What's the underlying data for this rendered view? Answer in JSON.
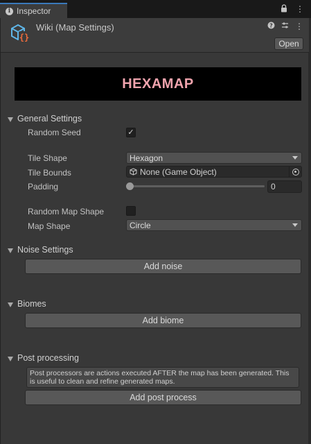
{
  "tab": {
    "title": "Inspector",
    "icon": "info-icon"
  },
  "tab_actions": [
    {
      "name": "lock-icon",
      "glyph": "🔒"
    },
    {
      "name": "more-icon",
      "glyph": "⋮"
    }
  ],
  "header": {
    "title": "Wiki (Map Settings)",
    "icon": "scriptable-object-icon",
    "open_label": "Open",
    "icons": [
      {
        "name": "help-icon",
        "glyph": "?"
      },
      {
        "name": "preset-icon",
        "glyph": "⇌"
      },
      {
        "name": "more-icon",
        "glyph": "⋮"
      }
    ]
  },
  "banner": {
    "text": "HEXAMAP",
    "color": "#f0a3ad"
  },
  "general": {
    "title": "General Settings",
    "random_seed": {
      "label": "Random Seed",
      "checked": true
    },
    "tile_shape": {
      "label": "Tile Shape",
      "value": "Hexagon"
    },
    "tile_bounds": {
      "label": "Tile Bounds",
      "value": "None (Game Object)"
    },
    "padding": {
      "label": "Padding",
      "value": "0",
      "slider_fraction": 0
    },
    "random_map_shape": {
      "label": "Random Map Shape",
      "checked": false
    },
    "map_shape": {
      "label": "Map Shape",
      "value": "Circle"
    }
  },
  "noise": {
    "title": "Noise Settings",
    "button": "Add noise"
  },
  "biomes": {
    "title": "Biomes",
    "button": "Add biome"
  },
  "post": {
    "title": "Post processing",
    "help": "Post processors are actions executed AFTER the map has been generated. This is useful to clean and refine generated maps.",
    "button": "Add post process"
  },
  "colors": {
    "accent": "#3a79bb",
    "panel": "#383838",
    "button": "#585858"
  }
}
